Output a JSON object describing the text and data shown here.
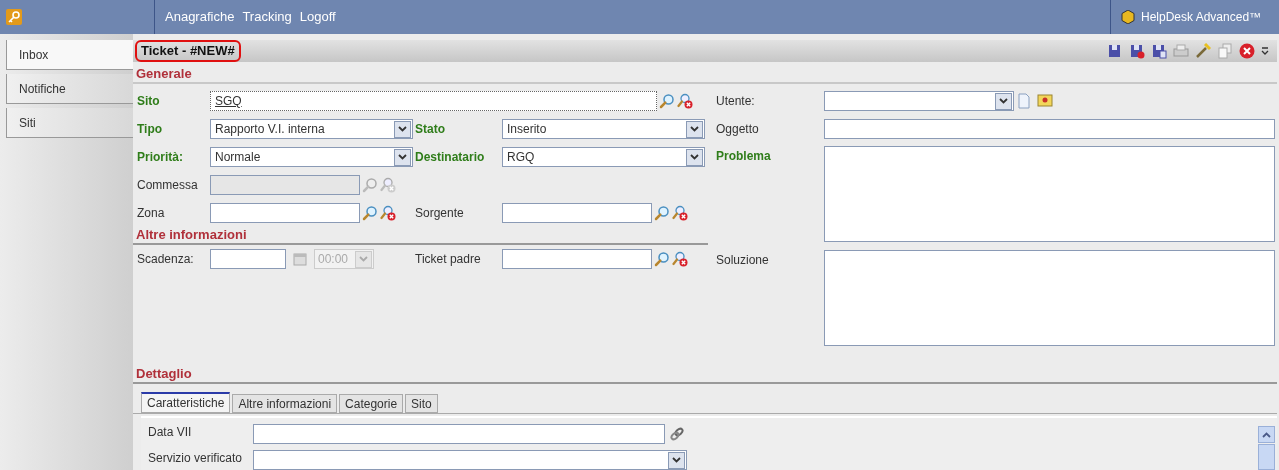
{
  "header": {
    "menu": [
      "Anagrafiche",
      "Tracking",
      "Logoff"
    ],
    "product": "HelpDesk Advanced™"
  },
  "sidebar": {
    "tabs": [
      {
        "label": "Inbox",
        "selected": true
      },
      {
        "label": "Notifiche",
        "selected": false
      },
      {
        "label": "Siti",
        "selected": false
      }
    ]
  },
  "title": "Ticket - #NEW#",
  "generale": {
    "title": "Generale",
    "rows": [
      [
        {
          "label": "Sito",
          "required": true,
          "kind": "lookup",
          "value": "SGQ",
          "disabled": false
        }
      ],
      [
        {
          "label": "Tipo",
          "required": true,
          "kind": "select",
          "value": "Rapporto V.I. interna"
        },
        {
          "label": "Stato",
          "required": true,
          "kind": "select",
          "value": "Inserito"
        }
      ],
      [
        {
          "label": "Priorità:",
          "required": true,
          "kind": "select",
          "value": "Normale"
        },
        {
          "label": "Destinatario",
          "required": true,
          "kind": "select",
          "value": "RGQ"
        }
      ],
      [
        {
          "label": "Commessa",
          "required": false,
          "kind": "lookup",
          "disabled": true
        }
      ],
      [
        {
          "label": "Zona",
          "required": false,
          "kind": "lookup",
          "disabled": false
        },
        {
          "label": "Sorgente",
          "required": false,
          "kind": "lookup",
          "disabled": false
        }
      ]
    ],
    "right": [
      {
        "label": "Utente:",
        "required": false,
        "kind": "user"
      },
      {
        "label": "Oggetto",
        "required": false,
        "kind": "text"
      },
      {
        "label": "Problema",
        "required": true,
        "kind": "textarea"
      },
      {
        "label": "Soluzione",
        "required": false,
        "kind": "textarea"
      }
    ]
  },
  "altre": {
    "title": "Altre informazioni",
    "rows": [
      [
        {
          "label": "Scadenza:",
          "required": false,
          "kind": "date",
          "time": "00:00",
          "time_disabled": true
        },
        {
          "label": "Ticket padre",
          "required": false,
          "kind": "lookup",
          "disabled": false
        }
      ]
    ]
  },
  "dettaglio": {
    "title": "Dettaglio",
    "tabs": [
      {
        "label": "Caratteristiche",
        "selected": true
      },
      {
        "label": "Altre informazioni",
        "selected": false
      },
      {
        "label": "Categorie",
        "selected": false
      },
      {
        "label": "Sito",
        "selected": false
      }
    ],
    "fields": [
      {
        "label": "Data VII",
        "kind": "link"
      },
      {
        "label": "Servizio verificato",
        "kind": "select"
      }
    ]
  }
}
